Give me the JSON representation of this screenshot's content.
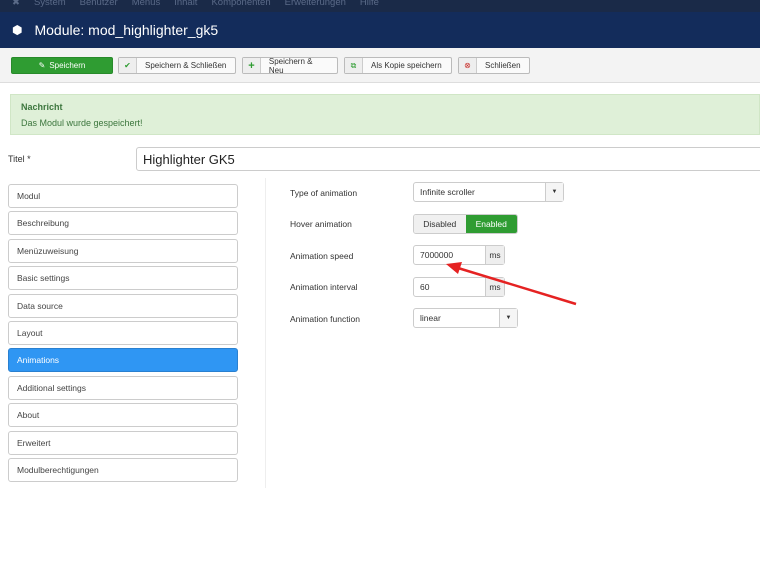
{
  "topnav": [
    "System",
    "Benutzer",
    "Menüs",
    "Inhalt",
    "Komponenten",
    "Erweiterungen",
    "Hilfe"
  ],
  "header": {
    "title": "Module: mod_highlighter_gk5"
  },
  "toolbar": {
    "save": "Speichern",
    "save_close": "Speichern & Schließen",
    "save_new": "Speichern & Neu",
    "save_copy": "Als Kopie speichern",
    "close": "Schließen"
  },
  "message": {
    "heading": "Nachricht",
    "text": "Das Modul wurde gespeichert!"
  },
  "title_field": {
    "label": "Titel *",
    "value": "Highlighter GK5"
  },
  "tabs": [
    "Modul",
    "Beschreibung",
    "Menüzuweisung",
    "Basic settings",
    "Data source",
    "Layout",
    "Animations",
    "Additional settings",
    "About",
    "Erweitert",
    "Modulberechtigungen"
  ],
  "active_tab": "Animations",
  "form": {
    "type_label": "Type of animation",
    "type_value": "Infinite scroller",
    "hover_label": "Hover animation",
    "hover_disabled": "Disabled",
    "hover_enabled": "Enabled",
    "speed_label": "Animation speed",
    "speed_value": "7000000",
    "speed_unit": "ms",
    "interval_label": "Animation interval",
    "interval_value": "60",
    "interval_unit": "ms",
    "function_label": "Animation function",
    "function_value": "linear"
  },
  "colors": {
    "header": "#132c5b",
    "success": "#2f9c32",
    "active_tab": "#2f96f3",
    "arrow": "#e52222"
  }
}
